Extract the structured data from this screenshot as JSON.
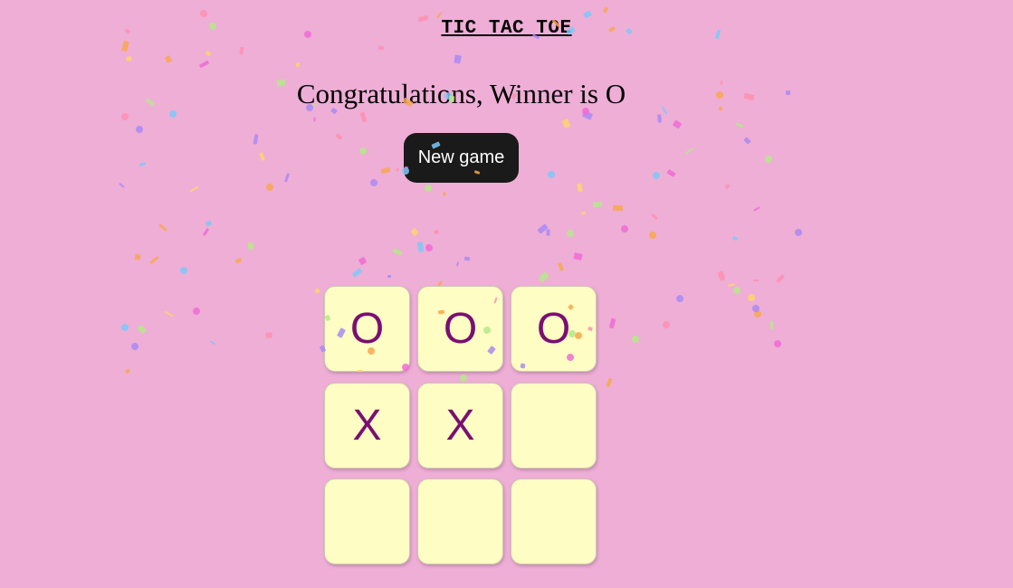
{
  "game": {
    "title": "TIC TAC TOE",
    "status": "Congratulations, Winner is O",
    "new_game_label": "New game",
    "winner": "O"
  },
  "board": {
    "cells": [
      "O",
      "O",
      "O",
      "X",
      "X",
      "",
      "",
      "",
      ""
    ]
  },
  "colors": {
    "background": "#eeaed6",
    "cell": "#fdfdc4",
    "mark": "#7a0f72",
    "button": "#1a1a1a",
    "confetti": [
      "#f06bd6",
      "#a98af5",
      "#7ec8f7",
      "#b6e88a",
      "#ffd36b",
      "#ff8fb0",
      "#f7a84e"
    ]
  }
}
